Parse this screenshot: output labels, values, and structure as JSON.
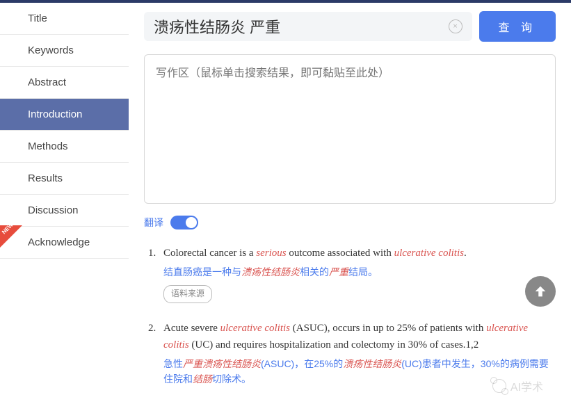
{
  "sidebar": {
    "items": [
      {
        "label": "Title",
        "active": false
      },
      {
        "label": "Keywords",
        "active": false
      },
      {
        "label": "Abstract",
        "active": false
      },
      {
        "label": "Introduction",
        "active": true
      },
      {
        "label": "Methods",
        "active": false
      },
      {
        "label": "Results",
        "active": false
      },
      {
        "label": "Discussion",
        "active": false
      },
      {
        "label": "Acknowledge",
        "active": false,
        "new": true
      }
    ]
  },
  "search": {
    "value": "溃疡性结肠炎 严重",
    "clear_icon": "×",
    "query_label": "查 询"
  },
  "writing_area": {
    "placeholder": "写作区（鼠标单击搜索结果，即可黏贴至此处）"
  },
  "translate": {
    "label": "翻译",
    "on": true
  },
  "results": [
    {
      "num": "1.",
      "en_parts": [
        {
          "t": "Colorectal cancer is a ",
          "hl": false
        },
        {
          "t": "serious",
          "hl": true
        },
        {
          "t": " outcome associated with ",
          "hl": false
        },
        {
          "t": "ulcerative colitis",
          "hl": true
        },
        {
          "t": ".",
          "hl": false
        }
      ],
      "zh_parts": [
        {
          "t": "结直肠癌是一种与",
          "hl": false
        },
        {
          "t": "溃疡性结肠炎",
          "hl": true
        },
        {
          "t": "相关的",
          "hl": false
        },
        {
          "t": "严重",
          "hl": true
        },
        {
          "t": "结局。",
          "hl": false
        }
      ],
      "source_label": "语料来源"
    },
    {
      "num": "2.",
      "en_parts": [
        {
          "t": "Acute severe ",
          "hl": false
        },
        {
          "t": "ulcerative colitis",
          "hl": true
        },
        {
          "t": " (ASUC), occurs in up to 25% of patients with ",
          "hl": false
        },
        {
          "t": "ulcerative colitis",
          "hl": true
        },
        {
          "t": " (UC) and requires hospitalization and colectomy in 30% of cases.1,2",
          "hl": false
        }
      ],
      "zh_parts": [
        {
          "t": "急性",
          "hl": false
        },
        {
          "t": "严重溃疡性结肠炎",
          "hl": true
        },
        {
          "t": "(ASUC)，在25%的",
          "hl": false
        },
        {
          "t": "溃疡性结肠炎",
          "hl": true
        },
        {
          "t": "(UC)患者中发生，30%的病例需要住院和",
          "hl": false
        },
        {
          "t": "结肠",
          "hl": true
        },
        {
          "t": "切除术。",
          "hl": false
        }
      ]
    }
  ],
  "watermark": "AI学术",
  "new_badge_text": "NEW"
}
